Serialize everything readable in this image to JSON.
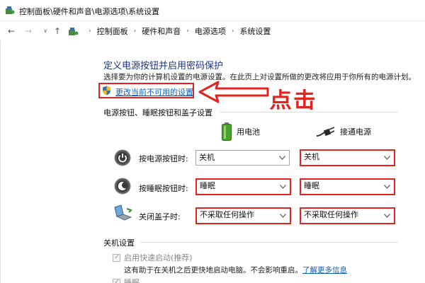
{
  "window": {
    "title": "控制面板\\硬件和声音\\电源选项\\系统设置"
  },
  "nav": {
    "back": "←",
    "forward": "→",
    "recent": "∨",
    "up": "↑",
    "breadcrumbs": [
      "控制面板",
      "硬件和声音",
      "电源选项",
      "系统设置"
    ],
    "separator": "›"
  },
  "page": {
    "title": "定义电源按钮并启用密码保护",
    "subtitle": "选择要为你的计算机设置的电源设置。在此页上对设置所做的更改将应用于你所有的电源计划。",
    "change_link": "更改当前不可用的设置",
    "annotation": "点击"
  },
  "buttons_section": {
    "header": "电源按钮、睡眠按钮和盖子设置",
    "col_battery": "用电池",
    "col_plugged": "接通电源",
    "rows": [
      {
        "label": "按电源按钮时:",
        "battery": "关机",
        "plugged": "关机"
      },
      {
        "label": "按睡眠按钮时:",
        "battery": "睡眠",
        "plugged": "睡眠"
      },
      {
        "label": "关闭盖子时:",
        "battery": "不采取任何操作",
        "plugged": "不采取任何操作"
      }
    ]
  },
  "shutdown_section": {
    "header": "关机设置",
    "fast_startup_label": "启用快速启动(推荐)",
    "fast_startup_desc": "这有助于在关机之后更快地启动电脑。不会影响重启。",
    "learn_more": "了解更多信息",
    "sleep_label": "睡眠"
  },
  "colors": {
    "accent_red": "#e3231d",
    "link_blue": "#0a5fbf",
    "title_blue": "#1e3287"
  }
}
